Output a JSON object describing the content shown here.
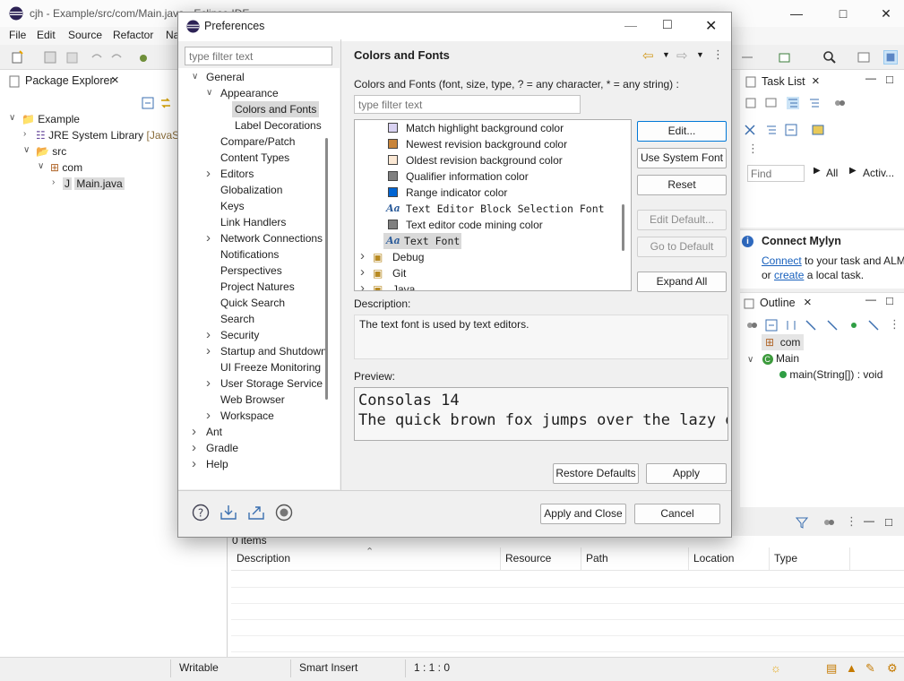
{
  "ide": {
    "title": "cjh - Example/src/com/Main.java - Eclipse IDE",
    "menu": [
      "File",
      "Edit",
      "Source",
      "Refactor",
      "Na"
    ],
    "package_explorer": {
      "tab_label": "Package Explorer",
      "tree": [
        {
          "label": "Example",
          "level": 0,
          "expanded": true
        },
        {
          "label": "JRE System Library",
          "suffix": "[JavaS",
          "level": 1,
          "expanded": false
        },
        {
          "label": "src",
          "level": 1,
          "expanded": true
        },
        {
          "label": "com",
          "level": 2,
          "expanded": true
        },
        {
          "label": "Main.java",
          "level": 3,
          "expanded": false
        }
      ]
    },
    "task_list": {
      "tab_label": "Task List",
      "find_placeholder": "Find",
      "all_label": "All",
      "activate_label": "Activ..."
    },
    "mylyn": {
      "title": "Connect Mylyn",
      "line1_link": "Connect",
      "line1_rest": " to your task and ALM",
      "line2_pre": "or ",
      "line2_link": "create",
      "line2_rest": " a local task."
    },
    "outline": {
      "tab_label": "Outline",
      "items": [
        {
          "label": "com"
        },
        {
          "label": "Main"
        },
        {
          "label": "main(String[]) : void"
        }
      ]
    },
    "problems": {
      "count_text": "0 items",
      "columns": [
        "Description",
        "Resource",
        "Path",
        "Location",
        "Type"
      ]
    },
    "status": {
      "writable": "Writable",
      "insert_mode": "Smart Insert",
      "position": "1 : 1 : 0"
    }
  },
  "dialog": {
    "title": "Preferences",
    "filter_placeholder": "type filter text",
    "tree": [
      {
        "label": "General",
        "level": 0,
        "expanded": true
      },
      {
        "label": "Appearance",
        "level": 1,
        "expanded": true
      },
      {
        "label": "Colors and Fonts",
        "level": 2,
        "selected": true
      },
      {
        "label": "Label Decorations",
        "level": 2
      },
      {
        "label": "Compare/Patch",
        "level": 1
      },
      {
        "label": "Content Types",
        "level": 1
      },
      {
        "label": "Editors",
        "level": 1,
        "expandable": true
      },
      {
        "label": "Globalization",
        "level": 1
      },
      {
        "label": "Keys",
        "level": 1
      },
      {
        "label": "Link Handlers",
        "level": 1
      },
      {
        "label": "Network Connections",
        "level": 1,
        "expandable": true
      },
      {
        "label": "Notifications",
        "level": 1
      },
      {
        "label": "Perspectives",
        "level": 1
      },
      {
        "label": "Project Natures",
        "level": 1
      },
      {
        "label": "Quick Search",
        "level": 1
      },
      {
        "label": "Search",
        "level": 1
      },
      {
        "label": "Security",
        "level": 1,
        "expandable": true
      },
      {
        "label": "Startup and Shutdown",
        "level": 1,
        "expandable": true
      },
      {
        "label": "UI Freeze Monitoring",
        "level": 1
      },
      {
        "label": "User Storage Service",
        "level": 1,
        "expandable": true
      },
      {
        "label": "Web Browser",
        "level": 1
      },
      {
        "label": "Workspace",
        "level": 1,
        "expandable": true
      },
      {
        "label": "Ant",
        "level": 0,
        "expandable": true
      },
      {
        "label": "Gradle",
        "level": 0,
        "expandable": true
      },
      {
        "label": "Help",
        "level": 0,
        "expandable": true
      }
    ],
    "page": {
      "title": "Colors and Fonts",
      "description": "Colors and Fonts (font, size, type, ? = any character, * = any string) :",
      "filter_placeholder": "type filter text",
      "items": [
        {
          "label": "Match highlight background color",
          "kind": "color",
          "color": "#d9d2f2"
        },
        {
          "label": "Newest revision background color",
          "kind": "color",
          "color": "#c8843a"
        },
        {
          "label": "Oldest revision background color",
          "kind": "color",
          "color": "#fbe8d4"
        },
        {
          "label": "Qualifier information color",
          "kind": "color",
          "color": "#808080"
        },
        {
          "label": "Range indicator color",
          "kind": "color",
          "color": "#0064d2"
        },
        {
          "label": "Text Editor Block Selection Font",
          "kind": "font"
        },
        {
          "label": "Text editor code mining color",
          "kind": "color",
          "color": "#808080"
        },
        {
          "label": "Text Font",
          "kind": "font",
          "selected": true
        },
        {
          "label": "Debug",
          "kind": "folder"
        },
        {
          "label": "Git",
          "kind": "folder"
        },
        {
          "label": "Java",
          "kind": "folder"
        }
      ],
      "buttons": {
        "edit": "Edit...",
        "use_system_font": "Use System Font",
        "reset": "Reset",
        "edit_default": "Edit Default...",
        "go_to_default": "Go to Default",
        "expand_all": "Expand All"
      },
      "description_label": "Description:",
      "description_text": "The text font is used by text editors.",
      "preview_label": "Preview:",
      "preview_line1": "Consolas 14",
      "preview_line2": "The quick brown fox jumps over the lazy d",
      "restore_defaults": "Restore Defaults",
      "apply": "Apply"
    },
    "footer": {
      "apply_close": "Apply and Close",
      "cancel": "Cancel"
    }
  }
}
